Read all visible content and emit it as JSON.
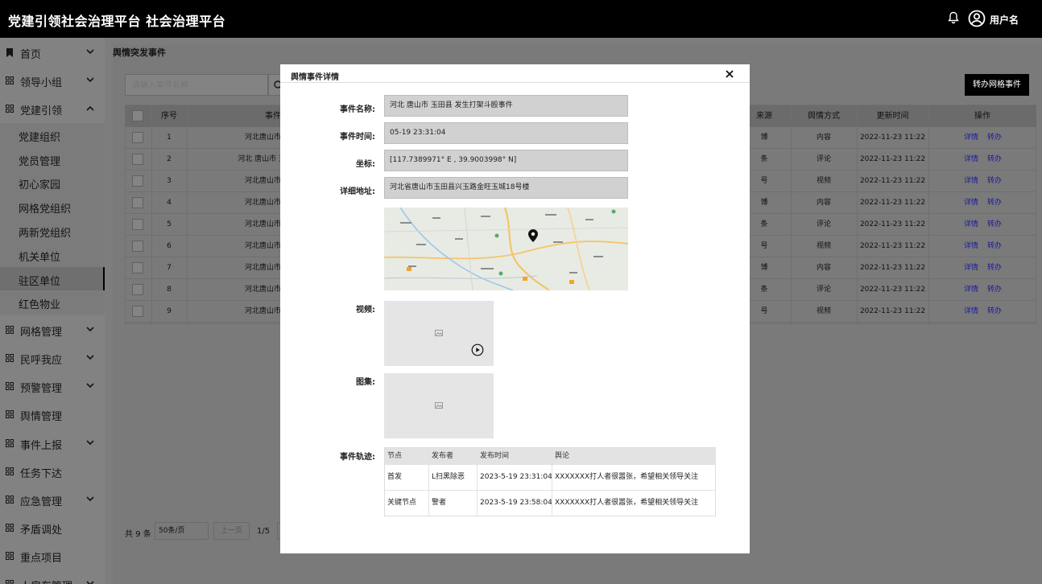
{
  "header": {
    "title": "党建引领社会治理平台  社会治理平台",
    "username": "用户名"
  },
  "sidebar": {
    "items": [
      {
        "label": "首页",
        "expanded": false
      },
      {
        "label": "领导小组",
        "expanded": false
      },
      {
        "label": "党建引领",
        "expanded": true
      },
      {
        "label": "网格管理",
        "expanded": false
      },
      {
        "label": "民呼我应",
        "expanded": false
      },
      {
        "label": "预警管理",
        "expanded": false
      },
      {
        "label": "舆情管理",
        "expanded": false
      },
      {
        "label": "事件上报",
        "expanded": false
      },
      {
        "label": "任务下达",
        "expanded": false
      },
      {
        "label": "应急管理",
        "expanded": false
      },
      {
        "label": "矛盾调处",
        "expanded": false
      },
      {
        "label": "重点项目",
        "expanded": false
      },
      {
        "label": "人房车管理",
        "expanded": false
      }
    ],
    "subitems": [
      "党建组织",
      "党员管理",
      "初心家园",
      "网格党组织",
      "两新党组织",
      "机关单位",
      "驻区单位",
      "红色物业"
    ],
    "active_subitem": "驻区单位"
  },
  "main": {
    "breadcrumb": "舆情突发事件",
    "search_placeholder": "请输入事件名称",
    "transfer_button": "转办网格事件",
    "table": {
      "headers": {
        "index": "序号",
        "title": "事件标题",
        "source": "来源",
        "method": "舆情方式",
        "updated": "更新时间",
        "actions": "操作"
      },
      "rows": [
        {
          "index": "1",
          "title": "河北唐山市古治区发生",
          "source": "博",
          "method": "内容",
          "updated": "2022-11-23 11:22"
        },
        {
          "index": "2",
          "title": "河北 唐山市 玉田县 发生打",
          "source": "条",
          "method": "评论",
          "updated": "2022-11-23 11:22"
        },
        {
          "index": "3",
          "title": "河北唐山市古治区发生",
          "source": "号",
          "method": "视频",
          "updated": "2022-11-23 11:22"
        },
        {
          "index": "4",
          "title": "河北唐山市古治区发生",
          "source": "博",
          "method": "内容",
          "updated": "2022-11-23 11:22"
        },
        {
          "index": "5",
          "title": "河北唐山市古治区发生",
          "source": "条",
          "method": "评论",
          "updated": "2022-11-23 11:22"
        },
        {
          "index": "6",
          "title": "河北唐山市古治区发生",
          "source": "号",
          "method": "视频",
          "updated": "2022-11-23 11:22"
        },
        {
          "index": "7",
          "title": "河北唐山市古治区发生",
          "source": "博",
          "method": "内容",
          "updated": "2022-11-23 11:22"
        },
        {
          "index": "8",
          "title": "河北唐山市古治区发生",
          "source": "条",
          "method": "评论",
          "updated": "2022-11-23 11:22"
        },
        {
          "index": "9",
          "title": "河北唐山市古治区发生",
          "source": "号",
          "method": "视频",
          "updated": "2022-11-23 11:22"
        }
      ],
      "action_detail": "详情",
      "action_transfer": "转办"
    },
    "pager": {
      "total": "共 9 条",
      "page_size": "50条/页",
      "prev": "上一页",
      "page": "1/5"
    }
  },
  "modal": {
    "title": "舆情事件详情",
    "fields": {
      "name_label": "事件名称:",
      "name_value": "河北 唐山市 玉田县 发生打架斗殴事件",
      "time_label": "事件时间:",
      "time_value": "05-19 23:31:04",
      "coord_label": "坐标:",
      "coord_value": "[117.7389971° E , 39.9003998° N]",
      "address_label": "详细地址:",
      "address_value": "河北省唐山市玉田县兴玉路金旺玉城18号楼",
      "video_label": "视频:",
      "gallery_label": "图集:",
      "track_label": "事件轨迹:"
    },
    "track": {
      "headers": [
        "节点",
        "发布者",
        "发布时间",
        "舆论"
      ],
      "rows": [
        [
          "首发",
          "L扫黑除恶",
          "2023-5-19 23:31:04",
          "XXXXXXX打人者很嚣张，希望相关领导关注"
        ],
        [
          "关键节点",
          "警者",
          "2023-5-19 23:58:04",
          "XXXXXXX打人者很嚣张，希望相关领导关注"
        ]
      ]
    }
  },
  "icons": {
    "bell": "bell-icon",
    "user": "user-circle-icon",
    "close": "close-icon",
    "play": "play-icon",
    "image": "image-placeholder-icon",
    "pin": "map-pin-icon"
  }
}
